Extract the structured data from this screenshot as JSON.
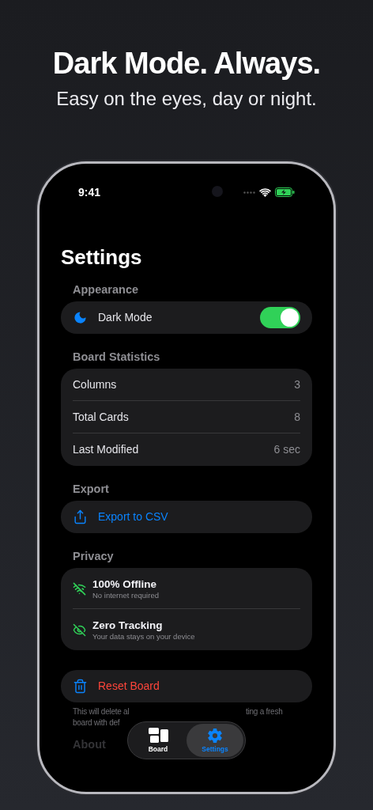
{
  "headline": {
    "title": "Dark Mode. Always.",
    "subtitle": "Easy on the eyes, day or night."
  },
  "status_bar": {
    "time": "9:41"
  },
  "title": "Settings",
  "sections": [
    {
      "header": "Appearance",
      "rows": [
        {
          "kind": "toggle",
          "label": "Dark Mode",
          "on": true
        }
      ]
    },
    {
      "header": "Board Statistics",
      "rows": [
        {
          "kind": "stat",
          "label": "Columns",
          "value": "3"
        },
        {
          "kind": "stat",
          "label": "Total Cards",
          "value": "8"
        },
        {
          "kind": "stat",
          "label": "Last Modified",
          "value": "6 sec"
        }
      ]
    },
    {
      "header": "Export",
      "rows": [
        {
          "kind": "action",
          "label": "Export to CSV"
        }
      ]
    },
    {
      "header": "Privacy",
      "rows": [
        {
          "kind": "feature",
          "title": "100% Offline",
          "subtitle": "No internet required"
        },
        {
          "kind": "feature",
          "title": "Zero Tracking",
          "subtitle": "Your data stays on your device"
        }
      ]
    },
    {
      "rows": [
        {
          "kind": "destructive",
          "label": "Reset Board"
        }
      ],
      "footnote": [
        [
          "This will delete al",
          "ting a fresh"
        ],
        [
          "board with def"
        ]
      ]
    },
    {
      "header": "About",
      "faded": true
    }
  ],
  "tab_bar": [
    {
      "label": "Board",
      "selected": false
    },
    {
      "label": "Settings",
      "selected": true
    }
  ]
}
